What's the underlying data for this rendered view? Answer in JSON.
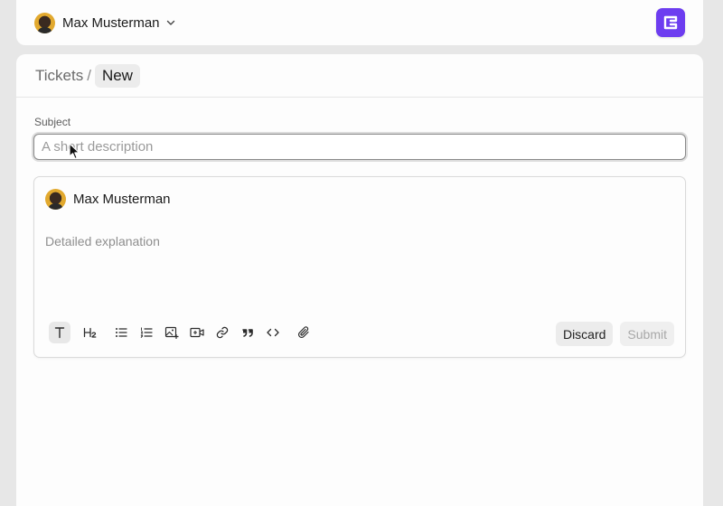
{
  "header": {
    "user_name": "Max Musterman",
    "logo_color": "#6d3df0"
  },
  "breadcrumb": {
    "parent": "Tickets",
    "separator": "/",
    "current": "New"
  },
  "form": {
    "subject_label": "Subject",
    "subject_placeholder": "A short description",
    "subject_value": ""
  },
  "editor": {
    "author_name": "Max Musterman",
    "body_placeholder": "Detailed explanation",
    "toolbar": [
      {
        "name": "paragraph",
        "icon": "text-icon"
      },
      {
        "name": "heading",
        "icon": "heading-2-icon"
      },
      {
        "name": "bullet-list",
        "icon": "bullet-list-icon"
      },
      {
        "name": "numbered-list",
        "icon": "numbered-list-icon"
      },
      {
        "name": "image",
        "icon": "image-add-icon"
      },
      {
        "name": "video",
        "icon": "video-add-icon"
      },
      {
        "name": "link",
        "icon": "link-icon"
      },
      {
        "name": "quote",
        "icon": "quote-icon"
      },
      {
        "name": "code",
        "icon": "code-icon"
      },
      {
        "name": "attachment",
        "icon": "paperclip-icon"
      }
    ],
    "discard_label": "Discard",
    "submit_label": "Submit"
  }
}
